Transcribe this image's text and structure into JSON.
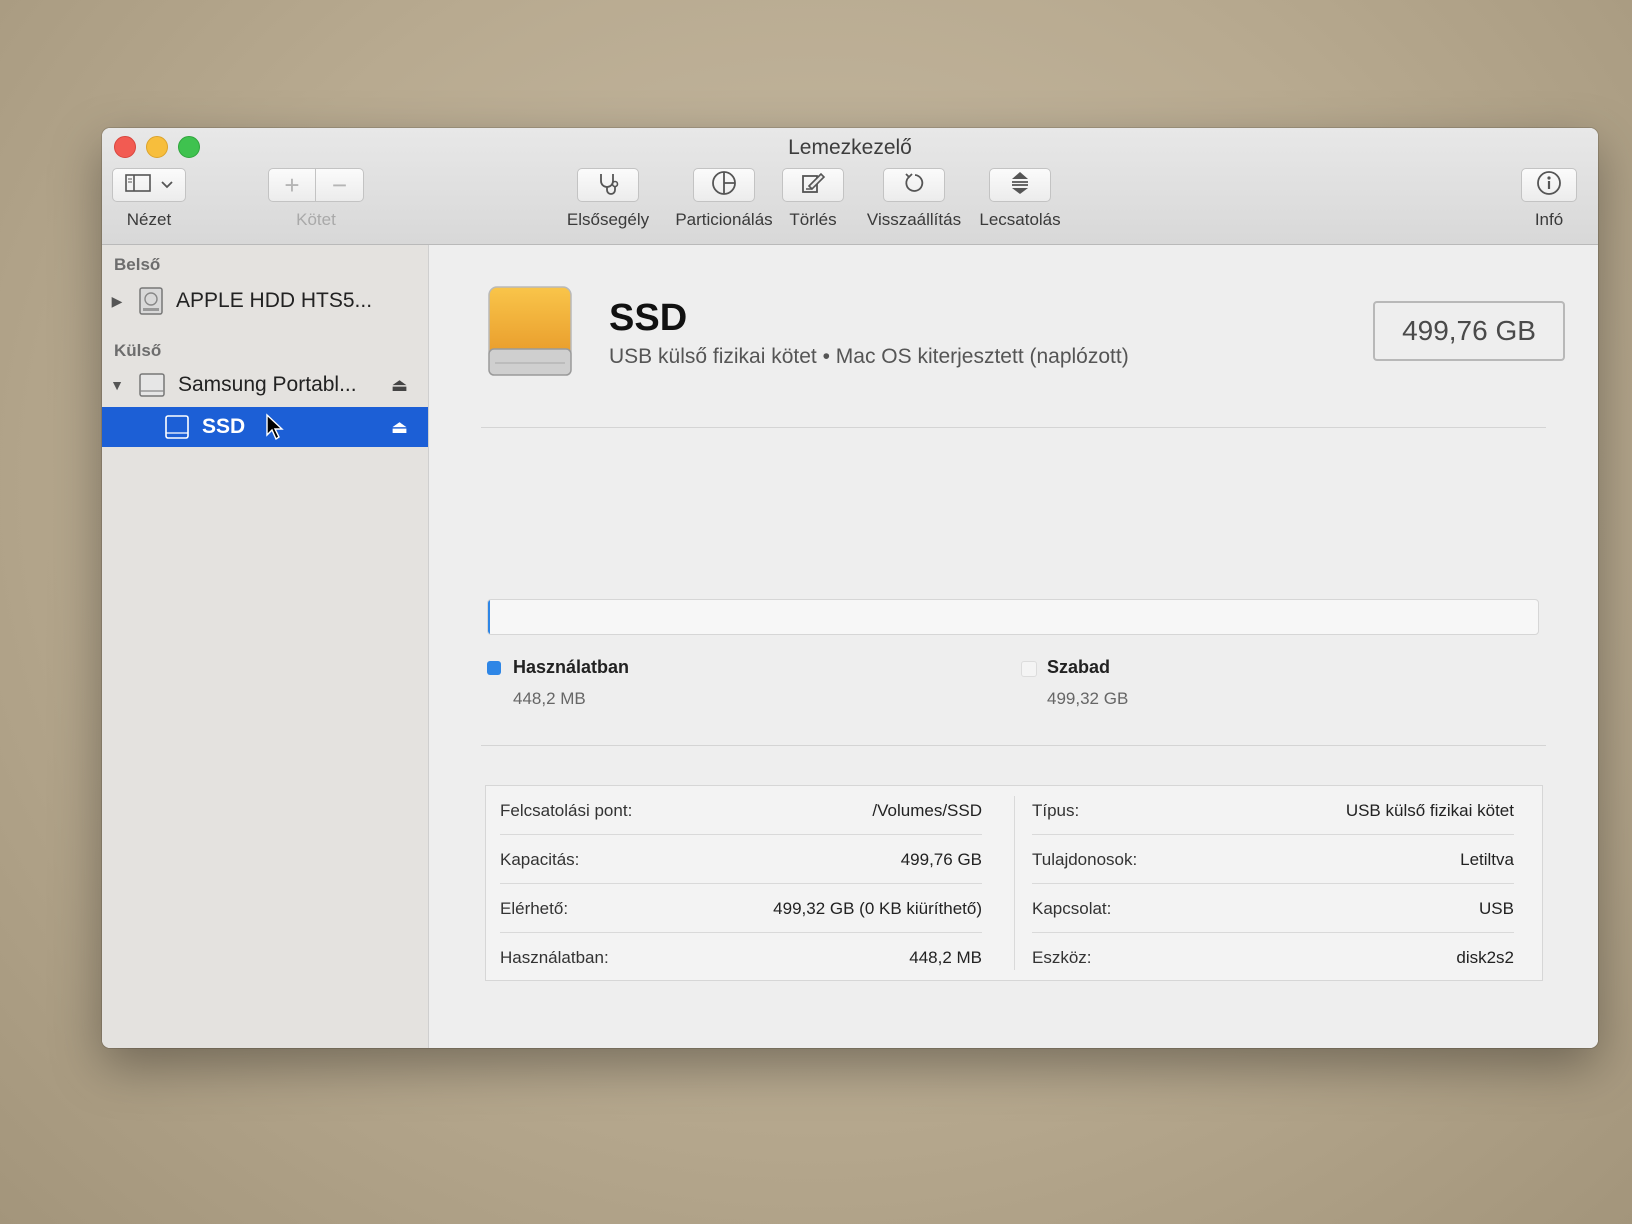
{
  "window": {
    "title": "Lemezkezelő"
  },
  "toolbar": {
    "view_label": "Nézet",
    "volume_label": "Kötet",
    "firstaid_label": "Elsősegély",
    "partition_label": "Particionálás",
    "erase_label": "Törlés",
    "restore_label": "Visszaállítás",
    "unmount_label": "Lecsatolás",
    "info_label": "Infó"
  },
  "sidebar": {
    "internal_header": "Belső",
    "external_header": "Külső",
    "internal_disk": "APPLE HDD HTS5...",
    "external_disk": "Samsung Portabl...",
    "selected_volume": "SSD"
  },
  "volume": {
    "name": "SSD",
    "subtitle": "USB külső fizikai kötet • Mac OS kiterjesztett (naplózott)",
    "capacity_badge": "499,76 GB",
    "used_fraction": 0.0009
  },
  "legend": {
    "used_title": "Használatban",
    "used_value": "448,2 MB",
    "free_title": "Szabad",
    "free_value": "499,32 GB"
  },
  "info": {
    "left": [
      {
        "label": "Felcsatolási pont:",
        "value": "/Volumes/SSD"
      },
      {
        "label": "Kapacitás:",
        "value": "499,76 GB"
      },
      {
        "label": "Elérhető:",
        "value": "499,32 GB (0 KB kiüríthető)"
      },
      {
        "label": "Használatban:",
        "value": "448,2 MB"
      }
    ],
    "right": [
      {
        "label": "Típus:",
        "value": "USB külső fizikai kötet"
      },
      {
        "label": "Tulajdonosok:",
        "value": "Letiltva"
      },
      {
        "label": "Kapcsolat:",
        "value": "USB"
      },
      {
        "label": "Eszköz:",
        "value": "disk2s2"
      }
    ]
  },
  "colors": {
    "selection": "#1c5fd6",
    "used": "#2e86e6",
    "drive_orange": "#f2a93b"
  }
}
